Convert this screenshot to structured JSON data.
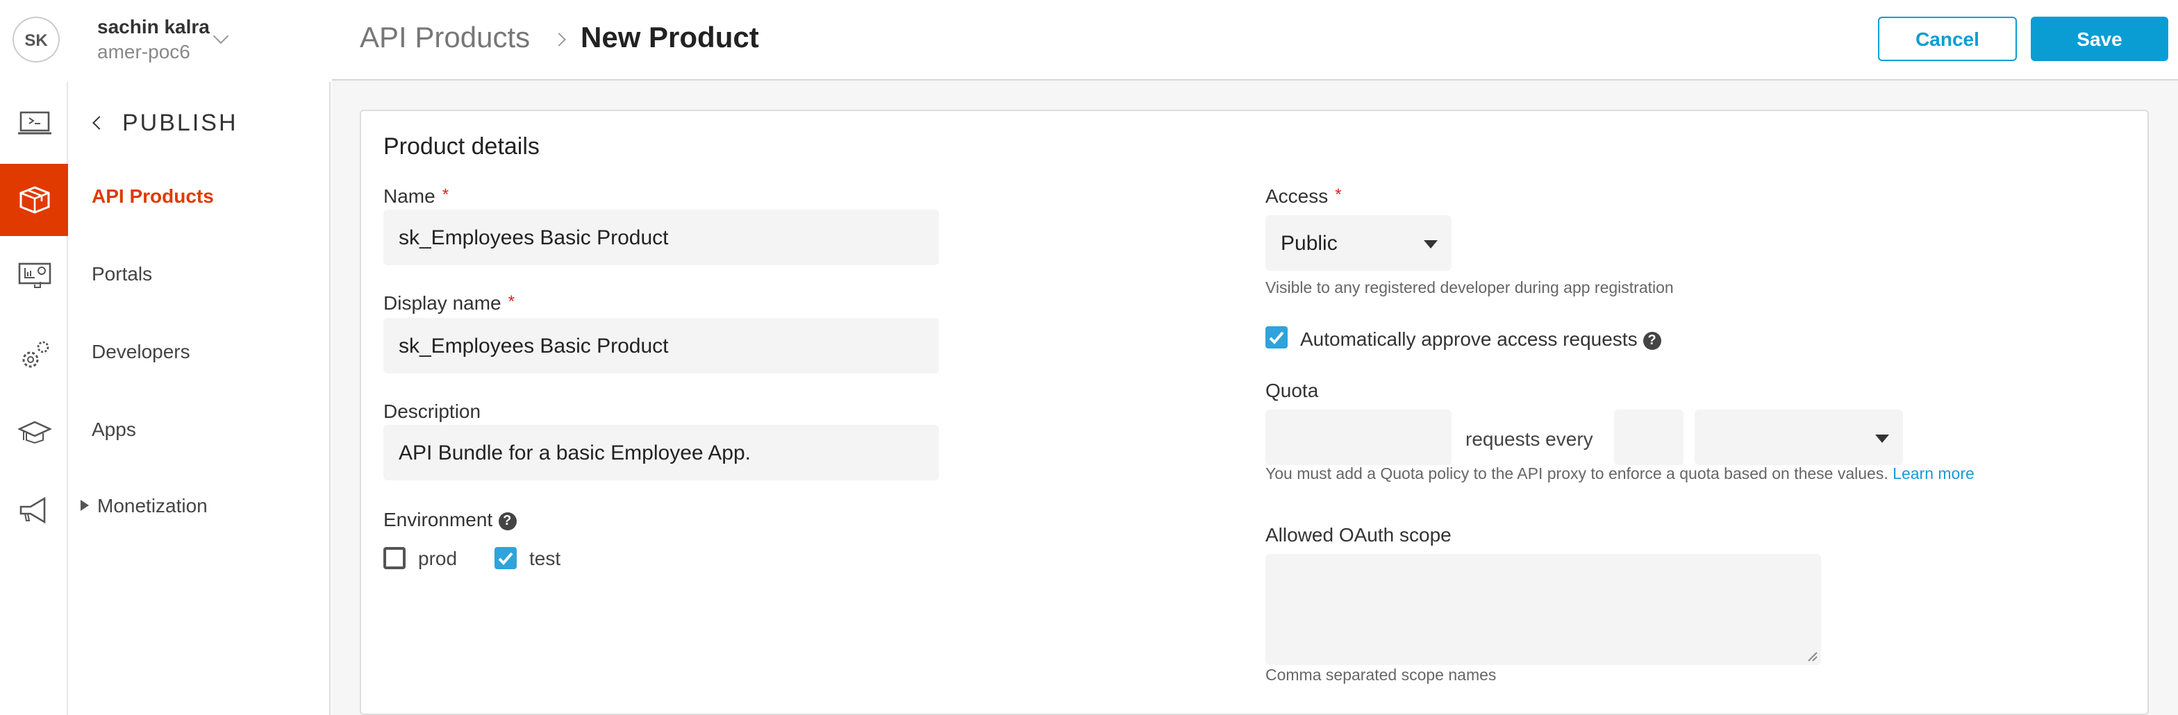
{
  "user": {
    "initials": "SK",
    "name": "sachin kalra",
    "org": "amer-poc6"
  },
  "nav": {
    "section": "PUBLISH",
    "items": [
      {
        "label": "API Products"
      },
      {
        "label": "Portals"
      },
      {
        "label": "Developers"
      },
      {
        "label": "Apps"
      },
      {
        "label": "Monetization"
      }
    ]
  },
  "rail_icons": [
    "terminal-icon",
    "package-icon",
    "dashboard-icon",
    "gears-icon",
    "graduation-cap-icon",
    "megaphone-icon"
  ],
  "header": {
    "breadcrumb": "API Products",
    "title": "New Product",
    "cancel": "Cancel",
    "save": "Save"
  },
  "form": {
    "section_title": "Product details",
    "name": {
      "label": "Name",
      "required": "*",
      "value": "sk_Employees Basic Product"
    },
    "display_name": {
      "label": "Display name",
      "required": "*",
      "value": "sk_Employees Basic Product"
    },
    "description": {
      "label": "Description",
      "value": "API Bundle for a basic Employee App."
    },
    "environment": {
      "label": "Environment",
      "help": "?",
      "options": [
        {
          "label": "prod",
          "checked": false
        },
        {
          "label": "test",
          "checked": true
        }
      ]
    },
    "access": {
      "label": "Access",
      "required": "*",
      "value": "Public",
      "help": "Visible to any registered developer during app registration"
    },
    "auto_approve": {
      "label": "Automatically approve access requests",
      "checked": true,
      "help": "?"
    },
    "quota": {
      "label": "Quota",
      "count": "",
      "between": "requests every",
      "interval": "",
      "unit": "",
      "help": "You must add a Quota policy to the API proxy to enforce a quota based on these values.",
      "link": "Learn more"
    },
    "oauth": {
      "label": "Allowed OAuth scope",
      "value": "",
      "help": "Comma separated scope names"
    }
  },
  "colors": {
    "accent": "#0a9dd4",
    "active": "#e03a00"
  }
}
